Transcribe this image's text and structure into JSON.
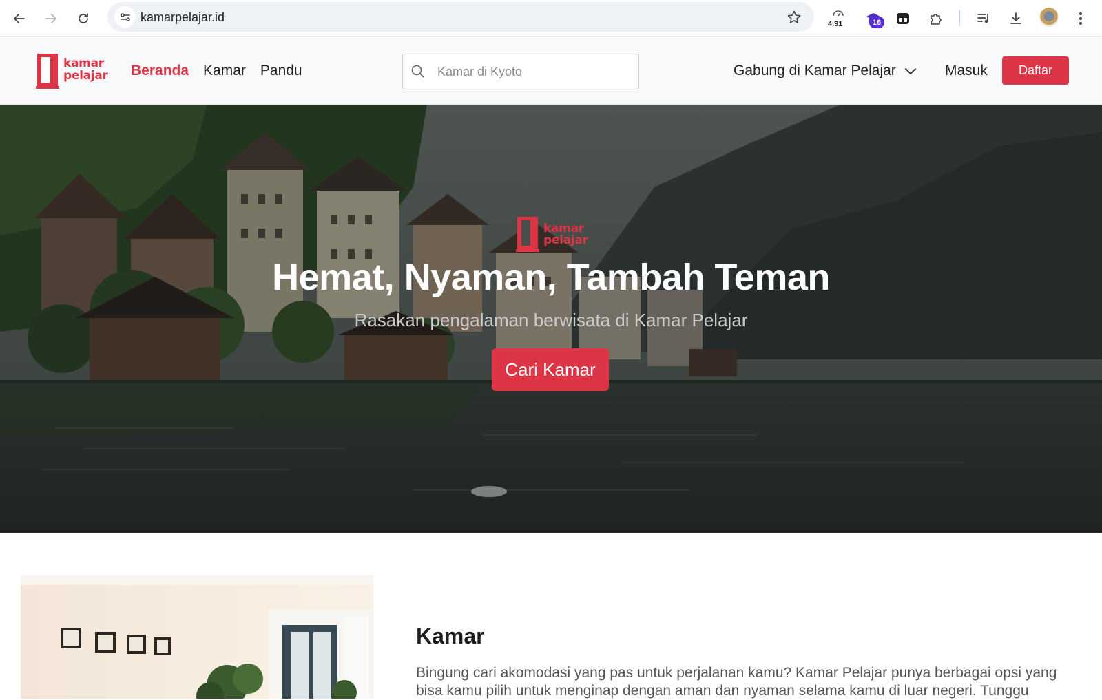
{
  "browser": {
    "url": "kamarpelajar.id",
    "extension_rating": "4.91",
    "extension_badge": "16",
    "icons": [
      "back-icon",
      "forward-icon",
      "reload-icon",
      "site-info-icon",
      "bookmark-star-icon",
      "extension-rating-icon",
      "extension-graduation-icon",
      "extension-tab-icon",
      "extensions-puzzle-icon",
      "media-queue-icon",
      "download-icon",
      "profile-avatar",
      "more-menu-icon"
    ]
  },
  "header": {
    "logo_line1": "kamar",
    "logo_line2": "pelajar",
    "nav": [
      {
        "label": "Beranda",
        "active": true
      },
      {
        "label": "Kamar",
        "active": false
      },
      {
        "label": "Pandu",
        "active": false
      }
    ],
    "search_placeholder": "Kamar di Kyoto",
    "join_label": "Gabung di Kamar Pelajar",
    "login_label": "Masuk",
    "register_label": "Daftar"
  },
  "hero": {
    "logo_line1": "kamar",
    "logo_line2": "pelajar",
    "title": "Hemat, Nyaman, Tambah Teman",
    "subtitle": "Rasakan pengalaman berwisata di Kamar Pelajar",
    "cta": "Cari Kamar"
  },
  "section": {
    "title": "Kamar",
    "description": "Bingung cari akomodasi yang pas untuk perjalanan kamu? Kamar Pelajar punya berbagai opsi yang bisa kamu pilih untuk menginap dengan aman dan nyaman selama kamu di luar negeri. Tunggu"
  },
  "colors": {
    "brand_red": "#dc3545",
    "header_bg": "#f8f9fa"
  }
}
